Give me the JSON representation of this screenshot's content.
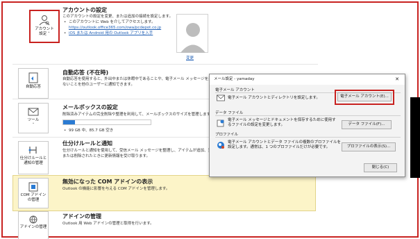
{
  "account": {
    "tile_label_1": "アカウント",
    "tile_label_2": "設定 ˅",
    "title": "アカウントの設定",
    "desc": "このアカウントの設定を変更、または追加の接続を設定します。",
    "bullet1": "このアカウントに Web を介してアクセスします。",
    "url": "https://outlook.office365.com/owa/pcdepot.co.jp",
    "bullet2_link": "iOS または Android 用の Outlook アプリを入手",
    "change_link": "変更"
  },
  "auto_reply": {
    "tile_label": "自動応答",
    "title": "自動応答 (不在時)",
    "desc1": "自動応答を使用すると、外出中または休暇中であることや、電子メール メッセージを返信で",
    "desc2": "ないことを他のユーザーに通知できます。"
  },
  "mailbox": {
    "tile_label_1": "ツール",
    "tile_label_2": "˅",
    "title": "メールボックスの設定",
    "desc": "削除済みアイテムの完全削除や整理を利用して、メールボックスのサイズを管理します。",
    "usage": "99 GB 中、85.7 GB 空き",
    "used_fraction": 0.134
  },
  "rules": {
    "tile_label_1": "仕分けルールと",
    "tile_label_2": "通知の管理",
    "title": "仕分けルールと通知",
    "desc1": "仕分けルールと通知を使用して、受信メール メッセージを整理し、アイテムが追加、変更、",
    "desc2": "または削除されたときに更新情報を受け取ります。"
  },
  "com": {
    "tile_label_1": "COM アドイン",
    "tile_label_2": "の管理",
    "title": "無効になった COM アドインの表示",
    "desc": "Outlook の機能に影響を与える COM アドインを管理します。"
  },
  "addins": {
    "tile_label": "アドインの管理",
    "title": "アドインの管理",
    "desc": "Outlook 用 Web アドインの管理と取得を行います。"
  },
  "dialog": {
    "title": "メール設定 - yamaday",
    "close": "✕",
    "group1": "電子メール アカウント",
    "text1": "電子メール アカウントとディレクトリを設定します。",
    "btn1": "電子メール アカウント(E)...",
    "group2": "データ ファイル",
    "text2a": "電子メール メッセージとドキュメントを保存するために使用す",
    "text2b": "るファイルの設定を変更します。",
    "btn2": "データ ファイル(F)...",
    "group3": "プロファイル",
    "text3a": "電子メール アカウントとデータ ファイルの複数のプロファイルを",
    "text3b": "設定します。通常は、1 つのプロファイルだけが必要です。",
    "btn3": "プロファイルの表示(S)...",
    "close_btn": "閉じる(C)"
  },
  "colors": {
    "highlight_red": "#c8211f",
    "link_blue": "#1f5fb5",
    "com_row_bg": "#fcf4c8",
    "progress_blue": "#2a7bd3"
  }
}
